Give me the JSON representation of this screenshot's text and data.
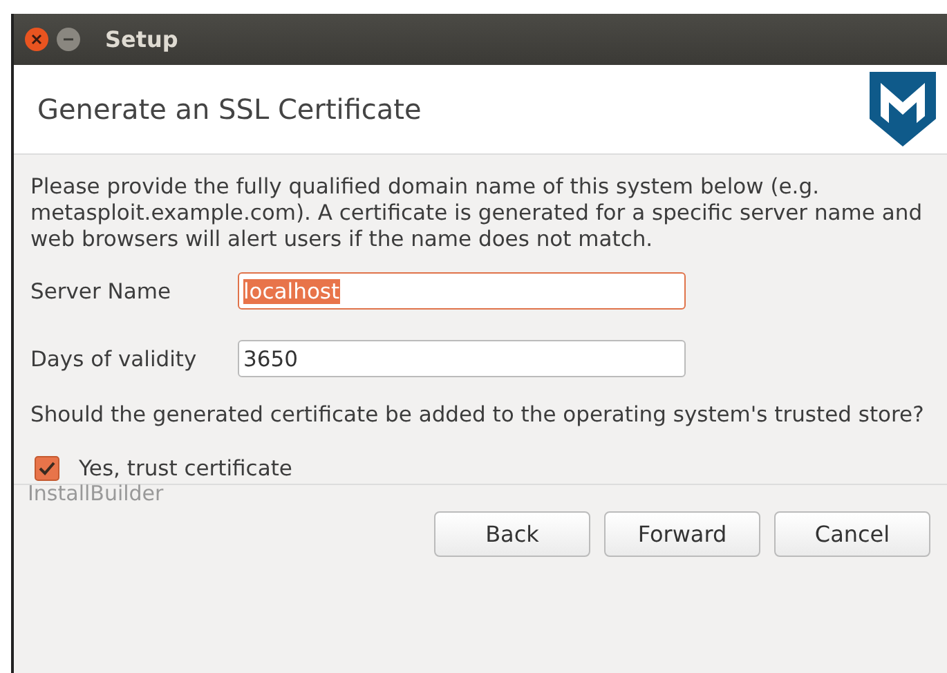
{
  "window": {
    "title": "Setup"
  },
  "header": {
    "title": "Generate an SSL Certificate"
  },
  "intro": "Please provide the fully qualified domain name of this system below (e.g. metasploit.example.com). A certificate is generated for a specific server name and web browsers will alert users if the name does not match.",
  "fields": [
    {
      "label": "Server Name",
      "value": "localhost",
      "focused": true
    },
    {
      "label": "Days of validity",
      "value": "3650",
      "focused": false
    }
  ],
  "question": "Should the generated certificate be added to the operating system's trusted store?",
  "checkbox": {
    "label": "Yes, trust certificate",
    "checked": true
  },
  "brand": "InstallBuilder",
  "buttons": [
    "Back",
    "Forward",
    "Cancel"
  ]
}
